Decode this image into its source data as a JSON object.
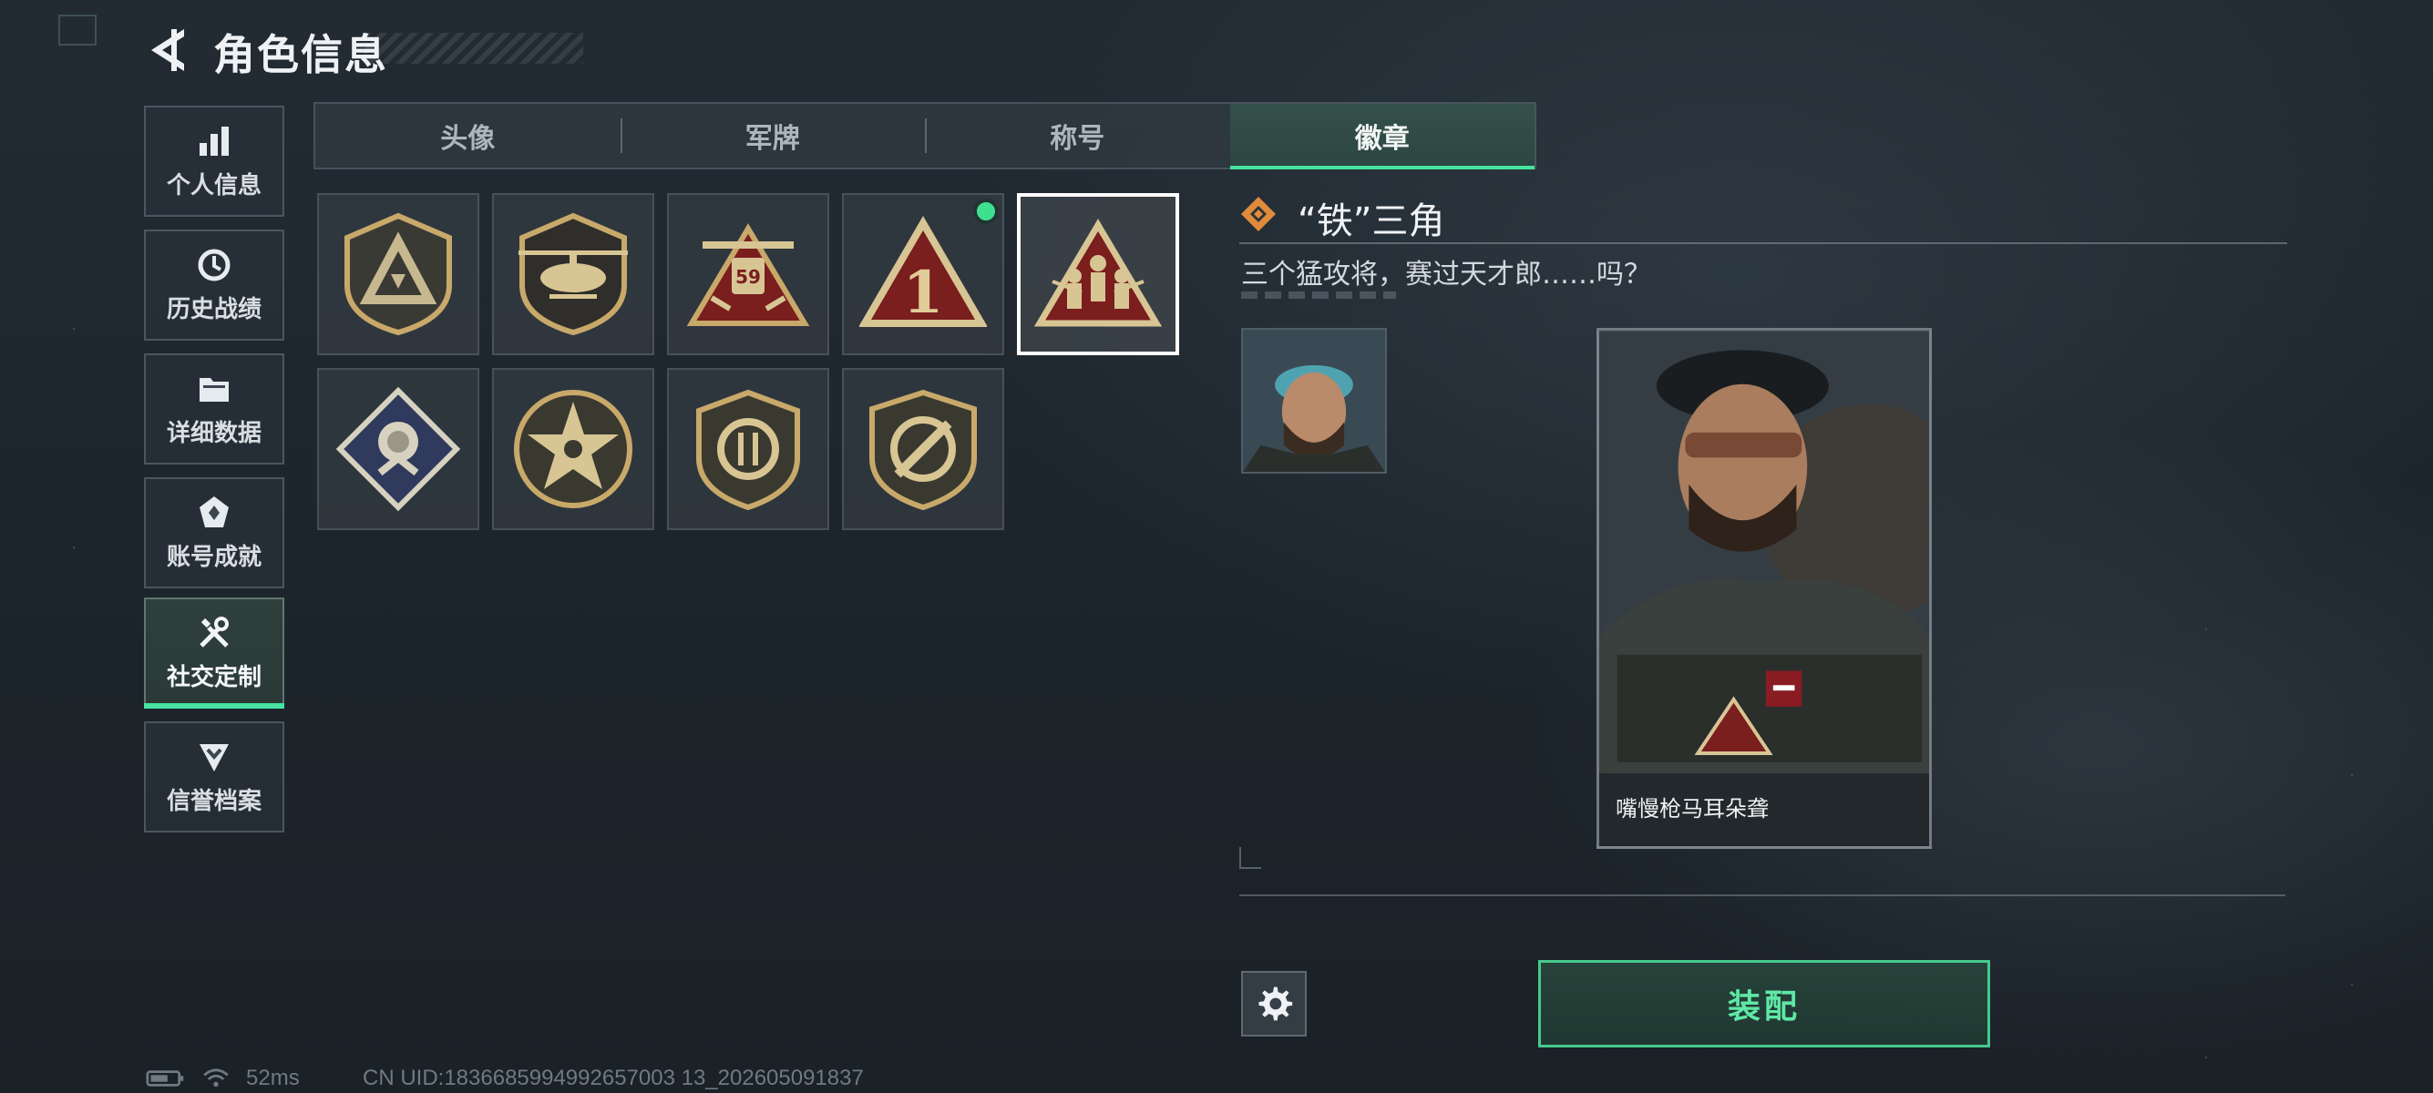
{
  "header": {
    "title": "角色信息"
  },
  "sidebar": {
    "items": [
      {
        "label": "个人信息",
        "icon": "bar-chart-icon",
        "active": false
      },
      {
        "label": "历史战绩",
        "icon": "clock-icon",
        "active": false
      },
      {
        "label": "详细数据",
        "icon": "folder-icon",
        "active": false
      },
      {
        "label": "账号成就",
        "icon": "achievement-icon",
        "active": false
      },
      {
        "label": "社交定制",
        "icon": "tools-icon",
        "active": true
      },
      {
        "label": "信誉档案",
        "icon": "shield-chevron-icon",
        "active": false
      }
    ]
  },
  "tabs": [
    {
      "label": "头像",
      "active": false
    },
    {
      "label": "军牌",
      "active": false
    },
    {
      "label": "称号",
      "active": false
    },
    {
      "label": "徽章",
      "active": true
    }
  ],
  "badges": [
    {
      "icon": "triangle-shield-badge-icon",
      "selected": false,
      "equipped": false
    },
    {
      "icon": "helicopter-badge-icon",
      "selected": false,
      "equipped": false
    },
    {
      "icon": "antenna-badge-icon",
      "selected": false,
      "equipped": false
    },
    {
      "icon": "number-one-triangle-badge-icon",
      "selected": false,
      "equipped": true
    },
    {
      "icon": "iron-triangle-soldiers-badge-icon",
      "selected": true,
      "equipped": false
    },
    {
      "icon": "rose-diamond-badge-icon",
      "selected": false,
      "equipped": false
    },
    {
      "icon": "star-circle-badge-icon",
      "selected": false,
      "equipped": false
    },
    {
      "icon": "arrows-shield-badge-icon",
      "selected": false,
      "equipped": false
    },
    {
      "icon": "knife-shield-badge-icon",
      "selected": false,
      "equipped": false
    }
  ],
  "detail": {
    "name": "“铁”三角",
    "description": "三个猛攻将，赛过天才郎……吗？",
    "card_name": "嘴慢枪马耳朵聋"
  },
  "actions": {
    "equip_label": "装配"
  },
  "status": {
    "ping": "52ms",
    "uid": "CN UID:1836685994992657003 13_202605091837"
  },
  "colors": {
    "accent": "#46e4a0",
    "background": "#1d252c",
    "badge_gold": "#c8a96a"
  }
}
